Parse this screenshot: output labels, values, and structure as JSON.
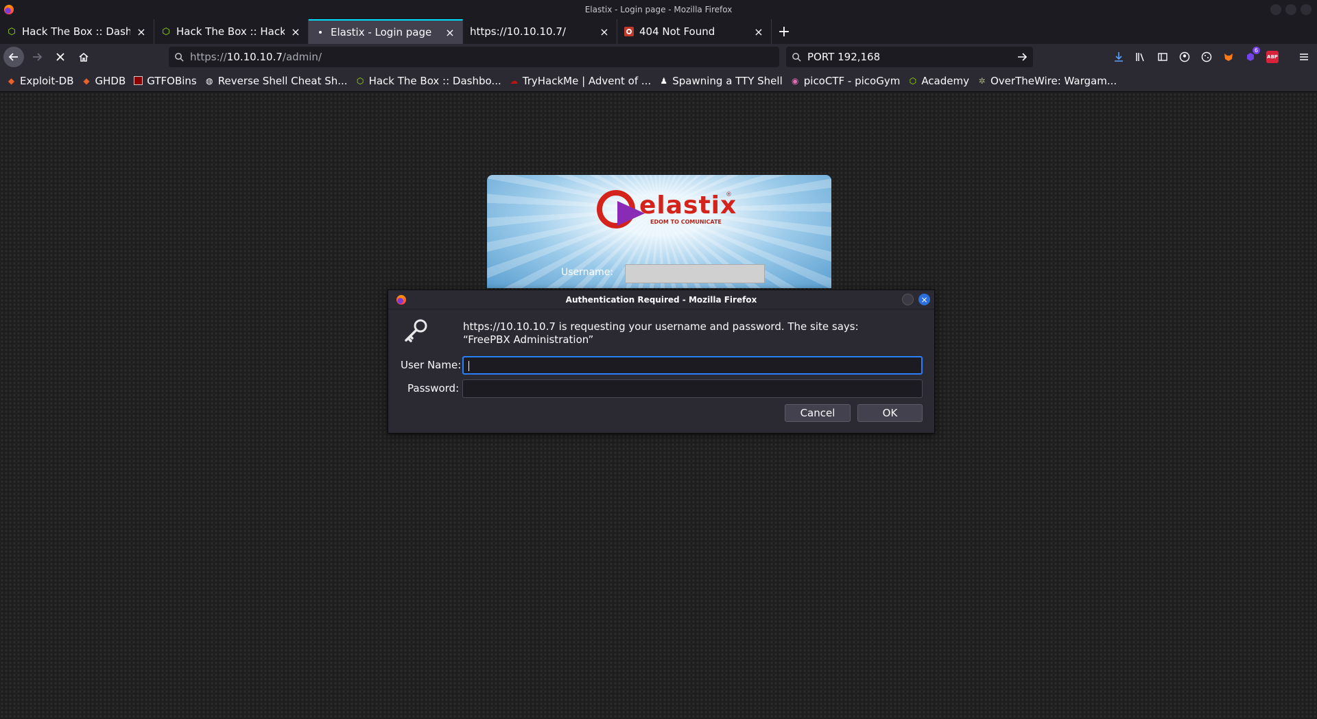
{
  "window": {
    "title": "Elastix - Login page - Mozilla Firefox"
  },
  "tabs": [
    {
      "label": "Hack The Box :: Dashbo",
      "icon": "htb-cube-icon",
      "active": false
    },
    {
      "label": "Hack The Box :: Hack Th",
      "icon": "htb-cube-icon",
      "active": false
    },
    {
      "label": "Elastix - Login page",
      "icon": "loading-dot-icon",
      "active": true
    },
    {
      "label": "https://10.10.10.7/",
      "icon": "",
      "active": false
    },
    {
      "label": "404 Not Found",
      "icon": "error-page-icon",
      "active": false
    }
  ],
  "navbar": {
    "url_prefix": "https://",
    "url_host": "10.10.10.7",
    "url_path": "/admin/",
    "search_query": "PORT 192,168",
    "extension_badge": "6",
    "abp_label": "ABP"
  },
  "bookmarks": [
    {
      "label": "Exploit-DB",
      "icon": "exploitdb-icon"
    },
    {
      "label": "GHDB",
      "icon": "ghdb-icon"
    },
    {
      "label": "GTFOBins",
      "icon": "gtfobins-icon"
    },
    {
      "label": "Reverse Shell Cheat Sh...",
      "icon": "globe-icon"
    },
    {
      "label": "Hack The Box :: Dashbo...",
      "icon": "htb-cube-icon"
    },
    {
      "label": "TryHackMe | Advent of ...",
      "icon": "tryhackme-icon"
    },
    {
      "label": "Spawning a TTY Shell",
      "icon": "tty-icon"
    },
    {
      "label": "picoCTF - picoGym",
      "icon": "picoctf-icon"
    },
    {
      "label": "Academy",
      "icon": "htb-cube-icon"
    },
    {
      "label": "OverTheWire: Wargam...",
      "icon": "overthewire-icon"
    }
  ],
  "elastix": {
    "logo_text": "elastix",
    "logo_tagline": "EDOM TO COMUNICATE",
    "logo_reg": "®",
    "username_label": "Username:"
  },
  "dialog": {
    "title": "Authentication Required - Mozilla Firefox",
    "message": "https://10.10.10.7 is requesting your username and password. The site says: “FreePBX Administration”",
    "username_label": "User Name:",
    "password_label": "Password:",
    "username_value": "",
    "password_value": "",
    "cancel_label": "Cancel",
    "ok_label": "OK"
  },
  "colors": {
    "focus": "#2a7fff",
    "elastix_red": "#d4231a",
    "htb_green": "#9fef00"
  }
}
